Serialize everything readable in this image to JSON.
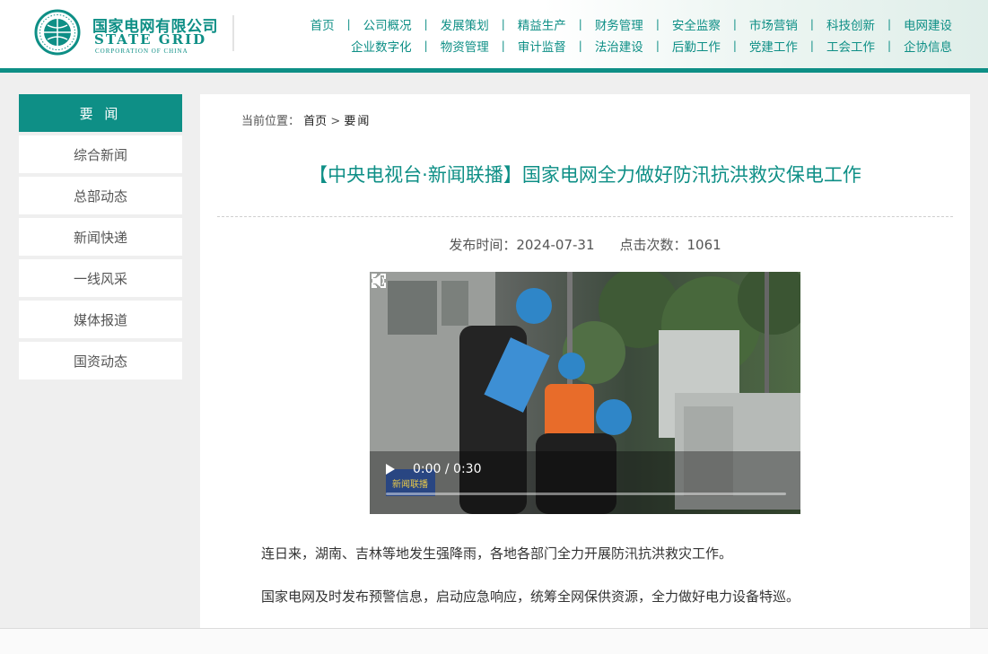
{
  "header": {
    "logo_cn": "国家电网有限公司",
    "logo_en": "STATE GRID",
    "logo_sub": "CORPORATION OF CHINA",
    "nav_row1": [
      "首页",
      "公司概况",
      "发展策划",
      "精益生产",
      "财务管理",
      "安全监察",
      "市场营销",
      "科技创新",
      "电网建设"
    ],
    "nav_row2": [
      "企业数字化",
      "物资管理",
      "审计监督",
      "法治建设",
      "后勤工作",
      "党建工作",
      "工会工作",
      "企协信息"
    ],
    "separator": "|"
  },
  "sidebar": {
    "heading": "要 闻",
    "items": [
      "综合新闻",
      "总部动态",
      "新闻快递",
      "一线风采",
      "媒体报道",
      "国资动态"
    ]
  },
  "breadcrumb": {
    "prefix": "当前位置：",
    "home": "首页",
    "arrow": ">",
    "current": "要闻"
  },
  "article": {
    "title": "【中央电视台·新闻联播】国家电网全力做好防汛抗洪救灾保电工作",
    "publish_label": "发布时间：2024-07-31",
    "views_label": "点击次数：1061",
    "video": {
      "time": "0:00 / 0:30",
      "progress": 0.0,
      "watermark": "新闻联播"
    },
    "paragraphs": [
      "连日来，湖南、吉林等地发生强降雨，各地各部门全力开展防汛抗洪救灾工作。",
      "国家电网及时发布预警信息，启动应急响应，统筹全网保供资源，全力做好电力设备特巡。"
    ]
  },
  "colors": {
    "brand": "#0e8f86",
    "page_bg": "#efefef"
  }
}
